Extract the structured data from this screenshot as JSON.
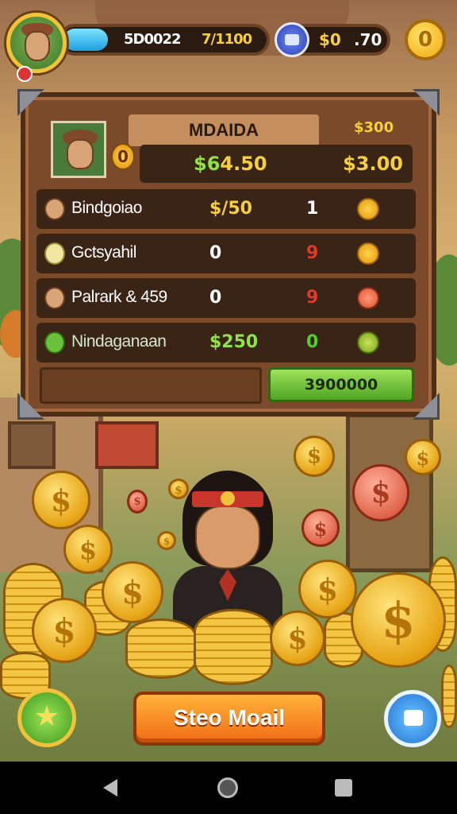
{
  "hud": {
    "xp_value_a": "5D0022",
    "xp_value_b": "7/1100",
    "xp_progress": 0.22,
    "gem_value": "$0",
    "gem_value_b": ".70",
    "coin_button_label": "0",
    "icons": {
      "avatar": "player-avatar",
      "gem": "gem-icon",
      "coin": "coin-icon"
    }
  },
  "board": {
    "title": "MDAIDA",
    "level": "0",
    "top_right": {
      "prefix": "$",
      "value": "300"
    },
    "summary": {
      "left_prefix": "$6",
      "left_value": "4.50",
      "right_prefix": "$",
      "right_value": "$3.00"
    },
    "rows": [
      {
        "name": "Bindgoiao",
        "amount": "$/50",
        "count": "1",
        "icon": "villager-icon",
        "count_color": "#ffffff"
      },
      {
        "name": "Gctsyahil",
        "amount": "0",
        "count": "9",
        "icon": "egg-icon",
        "count_color": "#e03a2a"
      },
      {
        "name": "Palrark & 459",
        "amount": "0",
        "count": "9",
        "icon": "villager-icon",
        "count_color": "#e03a2a"
      },
      {
        "name": "Nindaganaan",
        "amount": "$250",
        "count": "0",
        "icon": "leaf-icon",
        "count_color": "#4ed12a"
      }
    ],
    "action_button": "3900000"
  },
  "bottom": {
    "main_button": "Steo Moail",
    "star_icon": "star-icon",
    "chat_icon": "chat-icon"
  },
  "colors": {
    "accent_gold": "#f6d03c",
    "accent_green": "#8fe24a",
    "button_orange": "#f26b14",
    "wood": "#7a4a2a"
  }
}
